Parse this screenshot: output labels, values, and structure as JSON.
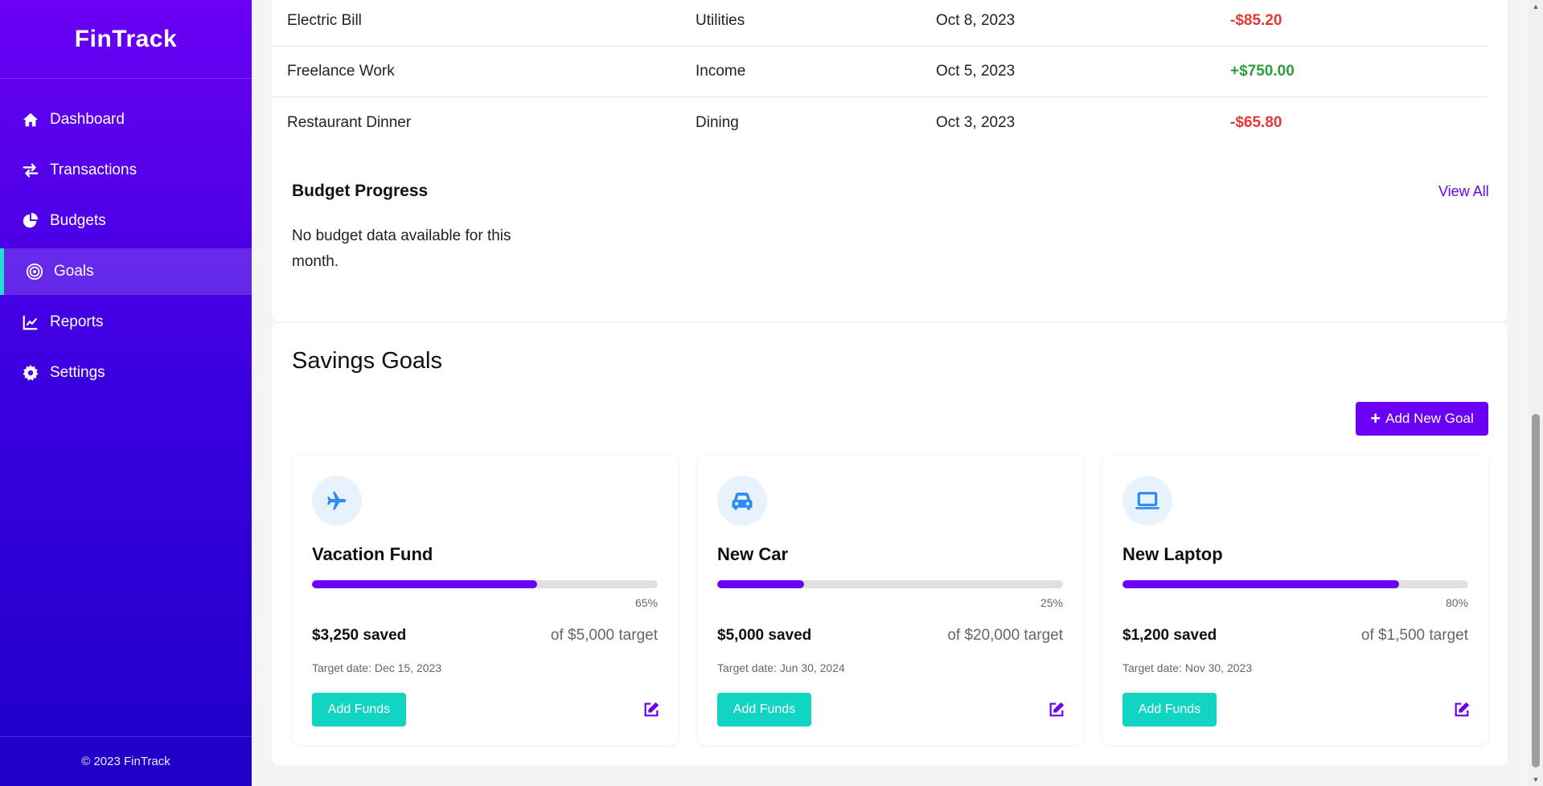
{
  "app": {
    "name": "FinTrack",
    "footer": "© 2023 FinTrack"
  },
  "sidebar": {
    "items": [
      {
        "label": "Dashboard",
        "icon": "home-icon"
      },
      {
        "label": "Transactions",
        "icon": "exchange-icon"
      },
      {
        "label": "Budgets",
        "icon": "pie-chart-icon"
      },
      {
        "label": "Goals",
        "icon": "target-icon",
        "active": true
      },
      {
        "label": "Reports",
        "icon": "line-chart-icon"
      },
      {
        "label": "Settings",
        "icon": "gear-icon"
      }
    ]
  },
  "transactions": [
    {
      "description": "Electric Bill",
      "category": "Utilities",
      "date": "Oct 8, 2023",
      "amount": "-$85.20"
    },
    {
      "description": "Freelance Work",
      "category": "Income",
      "date": "Oct 5, 2023",
      "amount": "+$750.00"
    },
    {
      "description": "Restaurant Dinner",
      "category": "Dining",
      "date": "Oct 3, 2023",
      "amount": "-$65.80"
    }
  ],
  "budget": {
    "title": "Budget Progress",
    "view_all": "View All",
    "empty": "No budget data available for this month."
  },
  "goals_section": {
    "title": "Savings Goals",
    "add_button": "Add New Goal",
    "goals": [
      {
        "name": "Vacation Fund",
        "icon": "plane-icon",
        "progress": 65,
        "progress_label": "65%",
        "saved": "$3,250 saved",
        "target": "of $5,000 target",
        "date": "Target date: Dec 15, 2023",
        "button": "Add Funds"
      },
      {
        "name": "New Car",
        "icon": "car-icon",
        "progress": 25,
        "progress_label": "25%",
        "saved": "$5,000 saved",
        "target": "of $20,000 target",
        "date": "Target date: Jun 30, 2024",
        "button": "Add Funds"
      },
      {
        "name": "New Laptop",
        "icon": "laptop-icon",
        "progress": 80,
        "progress_label": "80%",
        "saved": "$1,200 saved",
        "target": "of $1,500 target",
        "date": "Target date: Nov 30, 2023",
        "button": "Add Funds"
      }
    ]
  },
  "colors": {
    "accent": "#6a00f4",
    "teal": "#12d4c2",
    "negative": "#e53935",
    "positive": "#2e9e3e"
  }
}
